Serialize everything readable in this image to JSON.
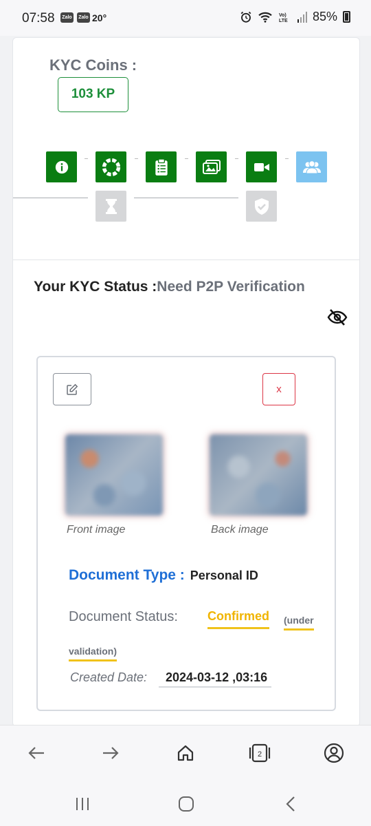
{
  "status_bar": {
    "time": "07:58",
    "notif_icons": [
      "Zalo",
      "Zalo"
    ],
    "temperature": "20°",
    "battery": "85%",
    "right_icons": [
      "alarm-icon",
      "wifi-icon",
      "volte-icon",
      "signal-icon",
      "battery-icon"
    ]
  },
  "kyc": {
    "coins_title": "KYC Coins :",
    "coins_value": "103 KP",
    "steps_top": [
      {
        "icon": "info-icon",
        "state": "done"
      },
      {
        "icon": "lifebuoy-icon",
        "state": "done"
      },
      {
        "icon": "clipboard-icon",
        "state": "done"
      },
      {
        "icon": "images-icon",
        "state": "done"
      },
      {
        "icon": "video-icon",
        "state": "done"
      },
      {
        "icon": "users-icon",
        "state": "current"
      }
    ],
    "steps_bottom": [
      {
        "icon": "hourglass-icon",
        "state": "pending"
      },
      {
        "icon": "shield-check-icon",
        "state": "pending"
      }
    ],
    "colors": {
      "done": "#0a7d12",
      "current": "#7cc3f0",
      "pending": "#d6d7d9"
    }
  },
  "status": {
    "label": "Your KYC Status :",
    "value": "Need P2P Verification"
  },
  "document": {
    "edit_icon": "edit-icon",
    "close_label": "x",
    "front_caption": "Front image",
    "back_caption": "Back image",
    "type_label": "Document Type :",
    "type_value": "Personal ID",
    "status_label": "Document Status:",
    "status_value": "Confirmed",
    "status_note_1": "(under",
    "status_note_2": "validation)",
    "created_label": "Created Date:",
    "created_value": "2024-03-12 ,03:16"
  },
  "browser_toolbar": {
    "tab_count": "2",
    "buttons": [
      "back-arrow-icon",
      "forward-arrow-icon",
      "home-icon",
      "tabs-icon",
      "account-icon"
    ]
  },
  "system_nav": [
    "recent-apps-icon",
    "home-circle-icon",
    "back-chevron-icon"
  ]
}
